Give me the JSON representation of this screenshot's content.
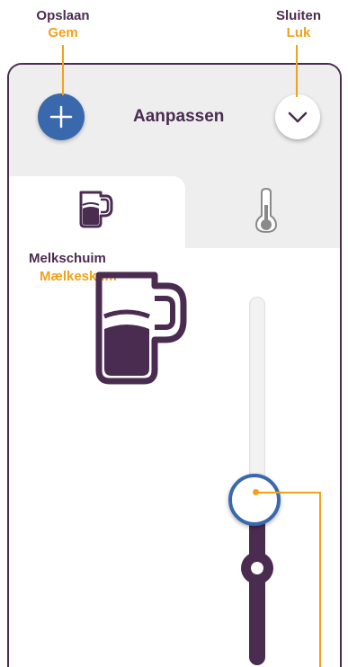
{
  "callouts": {
    "save": {
      "primary": "Opslaan",
      "secondary": "Gem"
    },
    "close": {
      "primary": "Sluiten",
      "secondary": "Luk"
    }
  },
  "header": {
    "title": "Aanpassen",
    "add_icon": "plus-icon",
    "close_icon": "chevron-down-icon"
  },
  "tabs": [
    {
      "icon": "milk-jug-icon",
      "active": true,
      "label_primary": "Melkschuim",
      "label_secondary": "Mælkeskum"
    },
    {
      "icon": "thermometer-icon",
      "active": false
    }
  ],
  "slider": {
    "level": 0.45
  },
  "colors": {
    "accent_blue": "#3a68ad",
    "plum": "#4a2c50",
    "callout_orange": "#f2a11a",
    "panel_grey": "#eeeeee"
  }
}
